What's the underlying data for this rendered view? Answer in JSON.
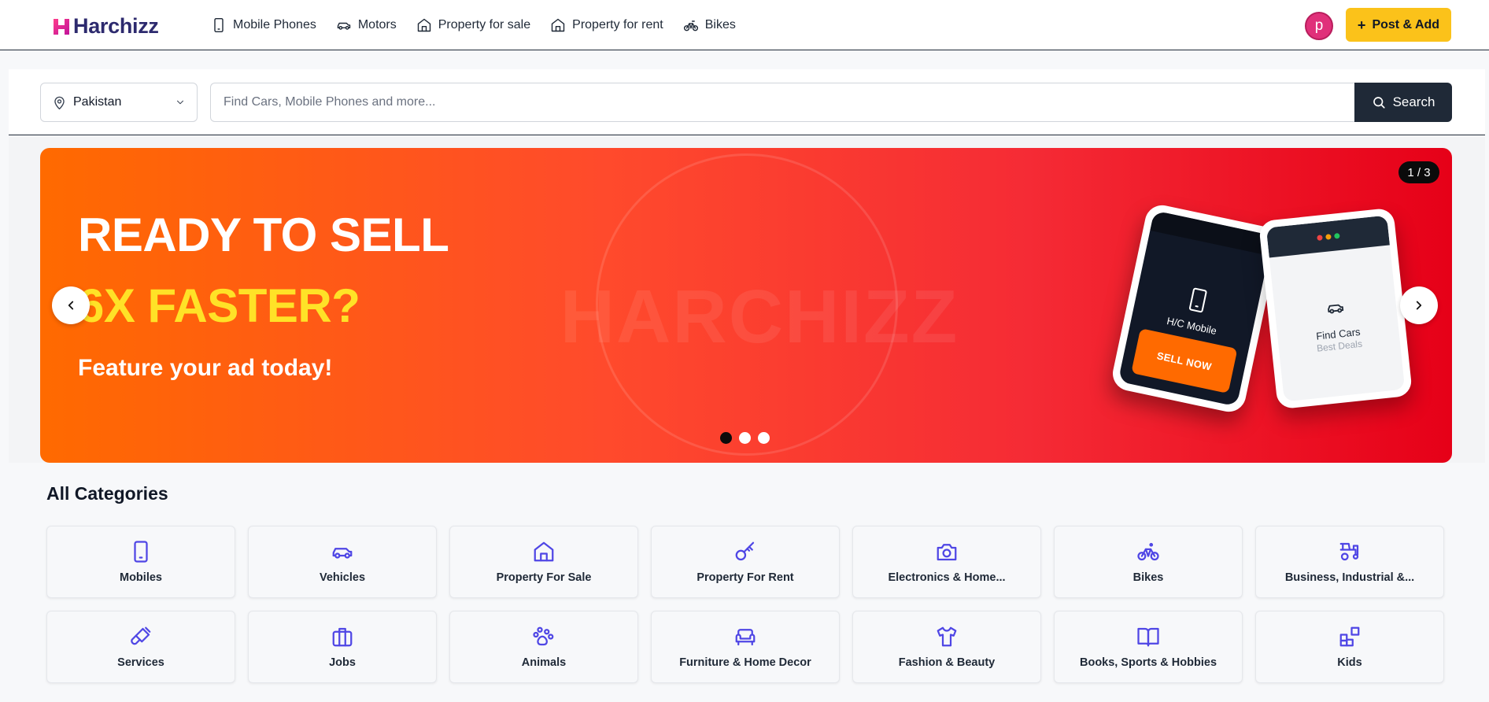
{
  "header": {
    "logo_text": "Harchizz",
    "logo_icon": "h-mark-logo",
    "nav": [
      {
        "label": "Mobile Phones",
        "icon": "smartphone-icon"
      },
      {
        "label": "Motors",
        "icon": "car-icon"
      },
      {
        "label": "Property for sale",
        "icon": "home-icon"
      },
      {
        "label": "Property for rent",
        "icon": "home-icon"
      },
      {
        "label": "Bikes",
        "icon": "bike-icon"
      }
    ],
    "avatar_initial": "p",
    "post_label": "Post & Add",
    "post_icon": "plus"
  },
  "search": {
    "location": "Pakistan",
    "placeholder": "Find Cars, Mobile Phones and more...",
    "value": "",
    "button_label": "Search"
  },
  "banner": {
    "headline_line1": "READY TO SELL",
    "headline_line2": "6X FASTER?",
    "subheadline": "Feature your ad today!",
    "watermark": "HARCHIZZ",
    "slide_counter": "1 / 3",
    "active_slide": 1,
    "slide_count": 3,
    "phone1": {
      "label": "H/C Mobile",
      "button": "SELL NOW"
    },
    "phone2": {
      "label": "Find Cars",
      "sublabel": "Best Deals"
    }
  },
  "categories": {
    "title": "All Categories",
    "items": [
      {
        "label": "Mobiles",
        "icon": "smartphone-icon"
      },
      {
        "label": "Vehicles",
        "icon": "car-icon"
      },
      {
        "label": "Property For Sale",
        "icon": "home-icon"
      },
      {
        "label": "Property For Rent",
        "icon": "key-icon"
      },
      {
        "label": "Electronics & Home...",
        "icon": "camera-icon"
      },
      {
        "label": "Bikes",
        "icon": "bike-icon"
      },
      {
        "label": "Business, Industrial &...",
        "icon": "tractor-icon"
      },
      {
        "label": "Services",
        "icon": "paintbrush-icon"
      },
      {
        "label": "Jobs",
        "icon": "briefcase-icon"
      },
      {
        "label": "Animals",
        "icon": "paw-icon"
      },
      {
        "label": "Furniture & Home Decor",
        "icon": "sofa-icon"
      },
      {
        "label": "Fashion & Beauty",
        "icon": "shirt-icon"
      },
      {
        "label": "Books, Sports & Hobbies",
        "icon": "book-icon"
      },
      {
        "label": "Kids",
        "icon": "blocks-icon"
      }
    ]
  },
  "colors": {
    "brand_primary": "#2d2a6e",
    "brand_accent": "#e91e8c",
    "post_button": "#fbc21a",
    "search_button": "#1f2937",
    "banner_start": "#ff6a00",
    "banner_end": "#e60018",
    "headline_highlight": "#ffe227",
    "category_icon": "#4f46e5",
    "avatar": "#e0307a"
  }
}
